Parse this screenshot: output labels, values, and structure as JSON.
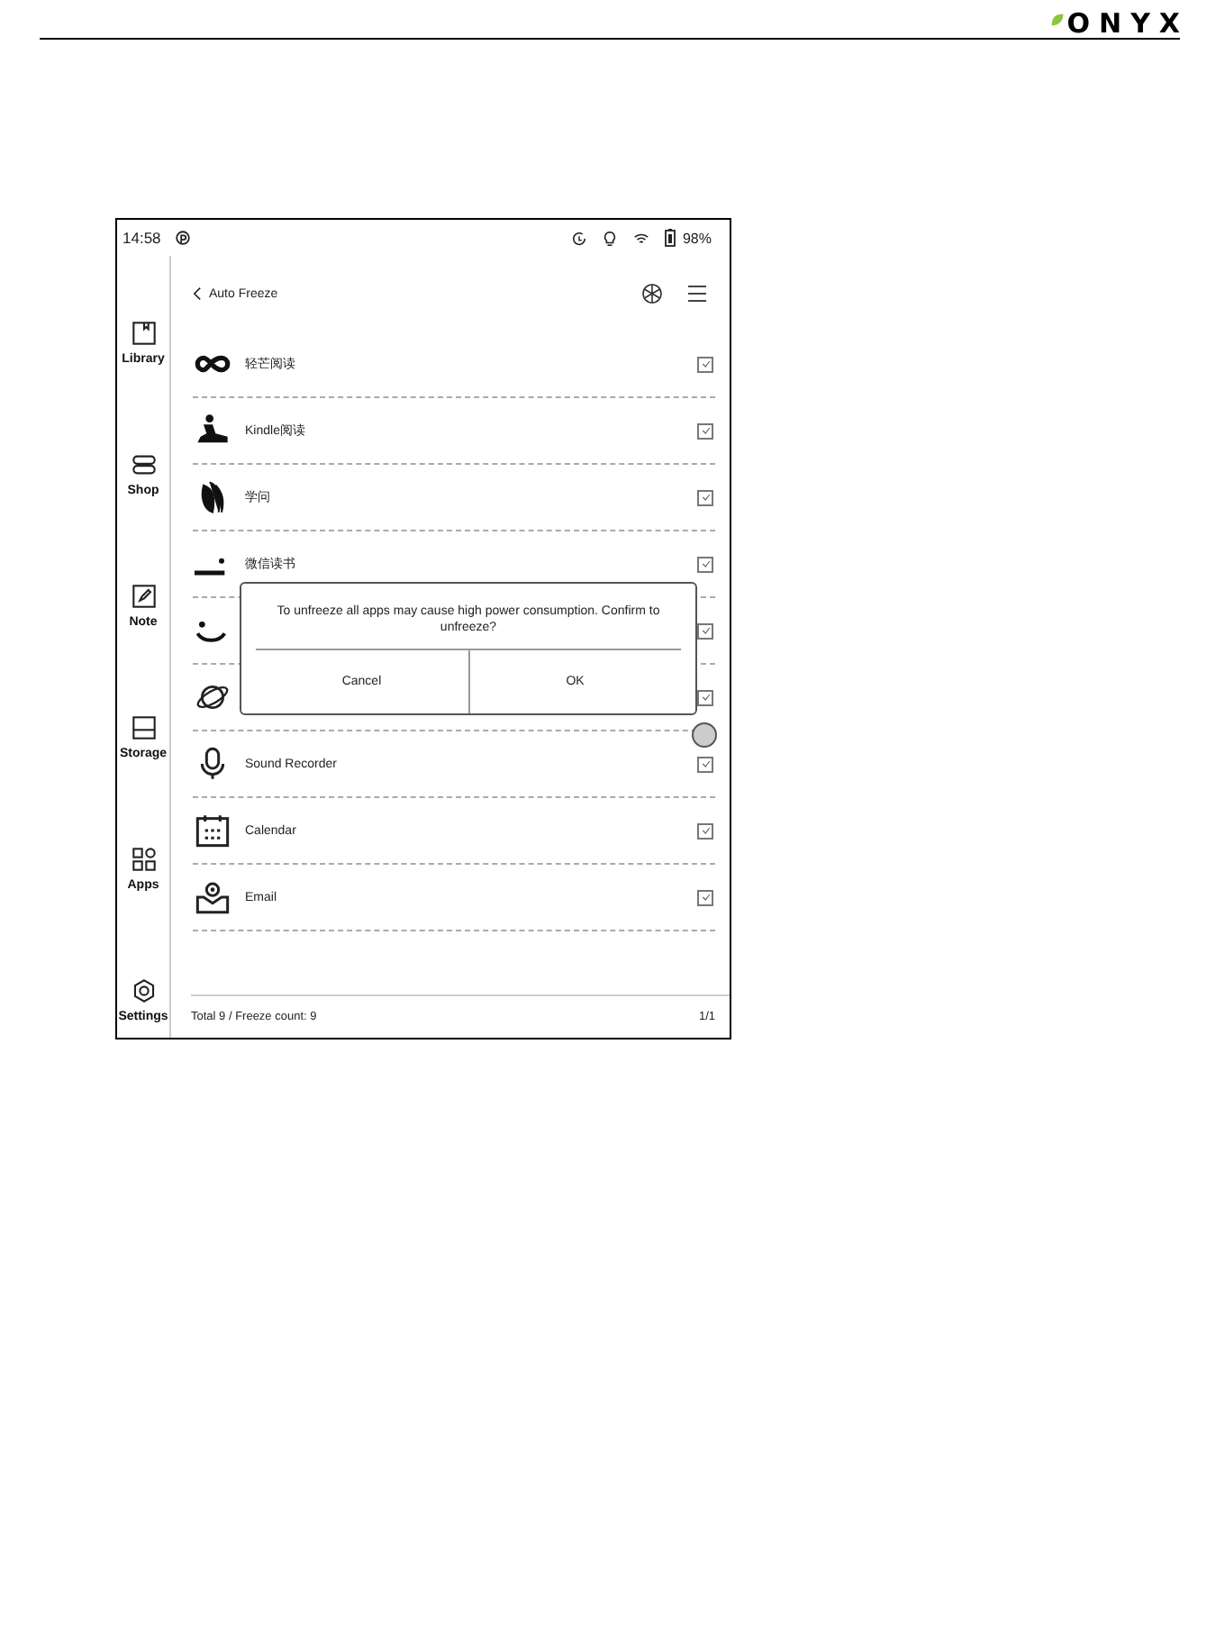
{
  "header": {
    "logo": "ONYX"
  },
  "device": {
    "status_bar": {
      "time": "14:58",
      "battery": "98%"
    },
    "sidebar": {
      "items": [
        {
          "label": "Library"
        },
        {
          "label": "Shop"
        },
        {
          "label": "Note"
        },
        {
          "label": "Storage"
        },
        {
          "label": "Apps"
        },
        {
          "label": "Settings"
        }
      ]
    },
    "title": "Auto Freeze",
    "apps": [
      {
        "name": "轻芒阅读",
        "checked": true
      },
      {
        "name": "Kindle阅读",
        "checked": true
      },
      {
        "name": "学问",
        "checked": true
      },
      {
        "name": "微信读书",
        "checked": true
      },
      {
        "checked": true
      },
      {
        "checked": true
      },
      {
        "name": "Sound Recorder",
        "checked": true
      },
      {
        "name": "Calendar",
        "checked": true
      },
      {
        "name": "Email",
        "checked": true
      }
    ],
    "footer": {
      "summary": "Total 9 / Freeze count: 9",
      "page": "1/1"
    },
    "dialog": {
      "message": "To unfreeze all apps may cause high power consumption. Confirm to unfreeze?",
      "buttons": [
        "Cancel",
        "OK"
      ]
    }
  }
}
